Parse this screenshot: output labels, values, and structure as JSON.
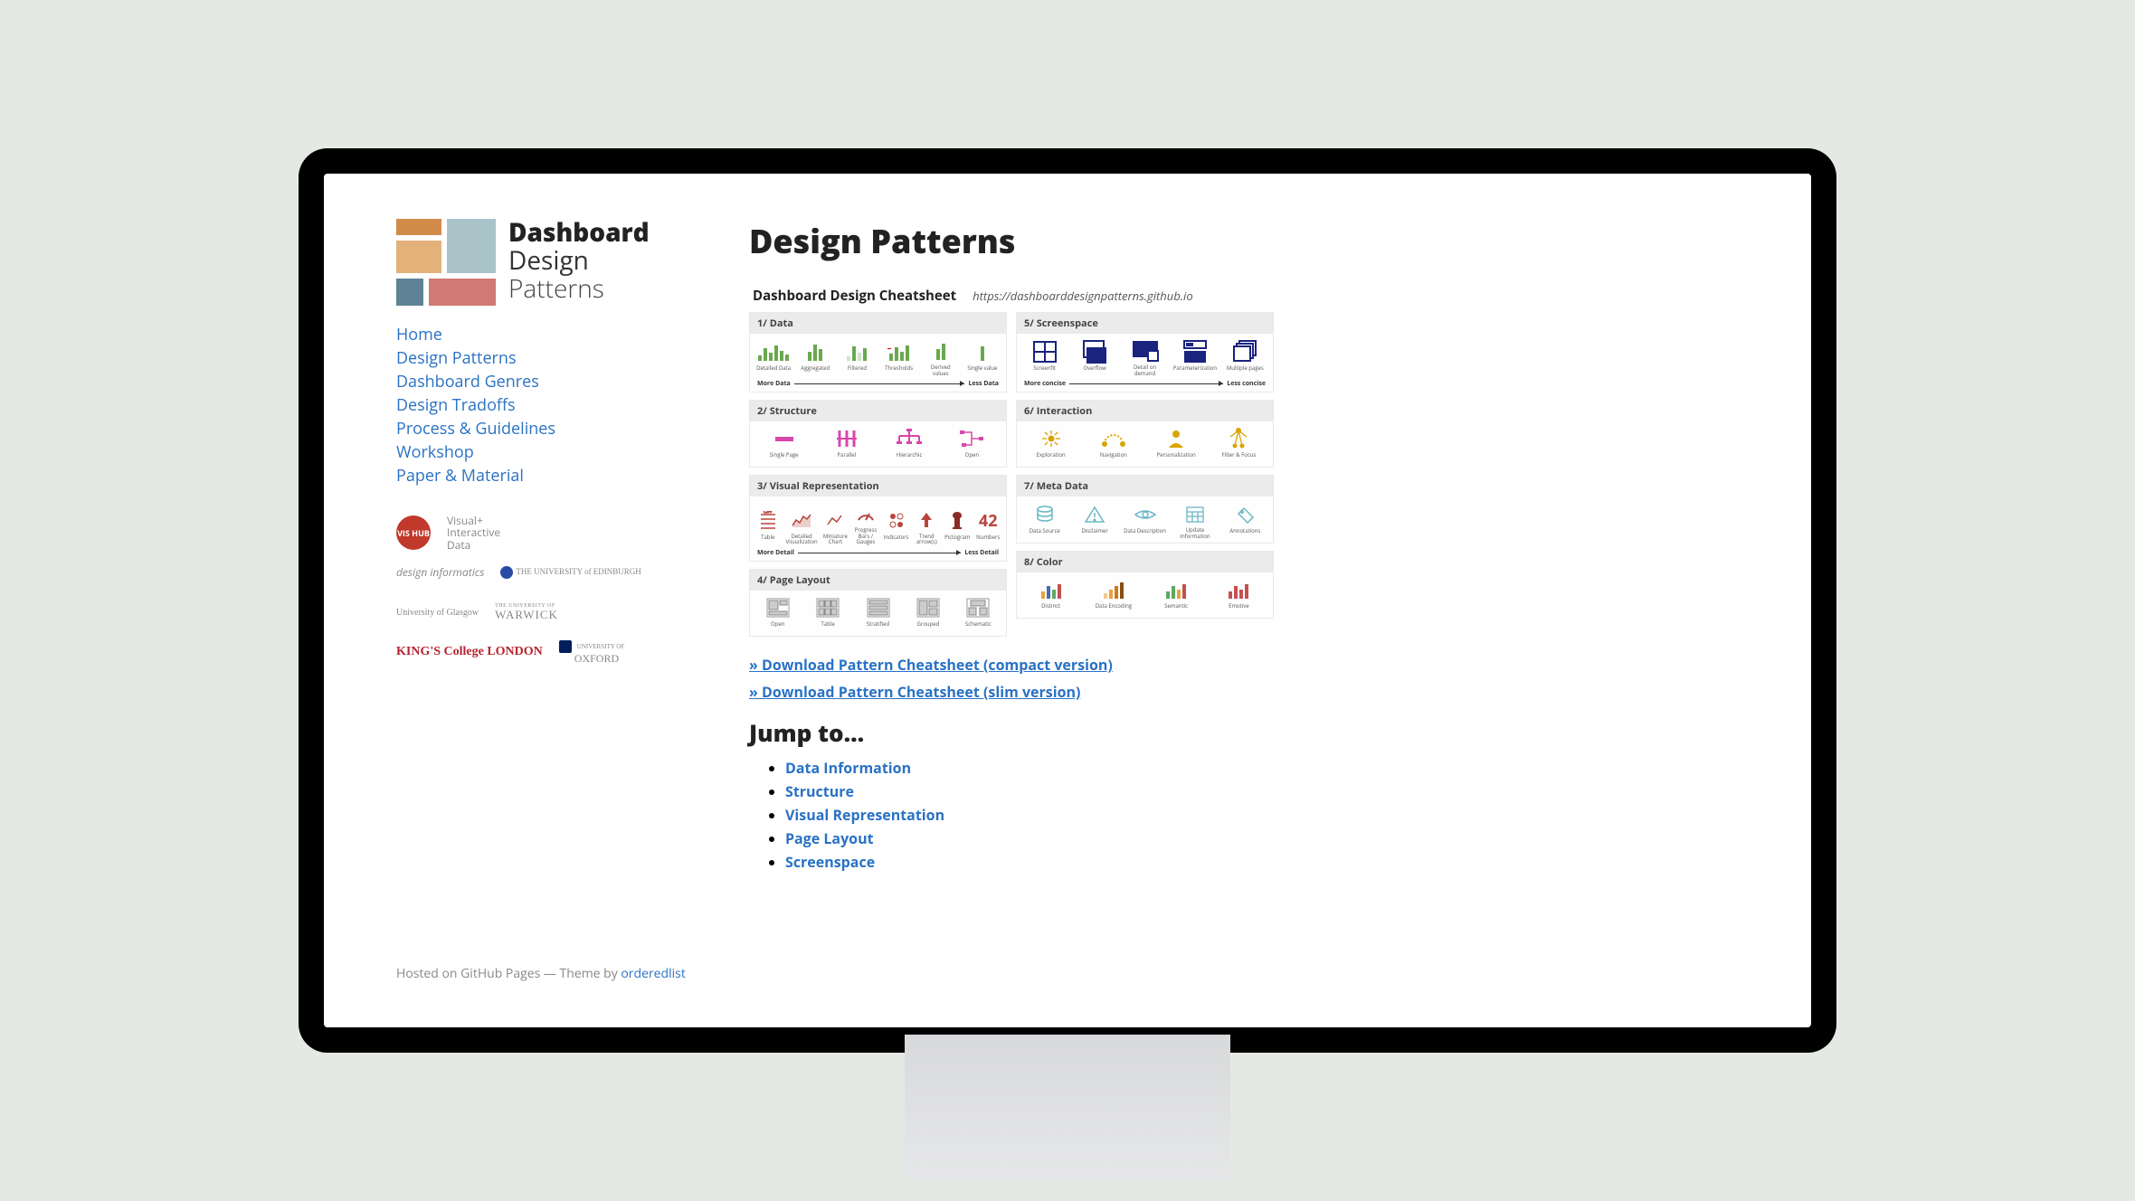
{
  "logo": {
    "line1": "Dashboard",
    "line2": "Design",
    "line3": "Patterns"
  },
  "nav": {
    "items": [
      {
        "label": "Home"
      },
      {
        "label": "Design Patterns"
      },
      {
        "label": "Dashboard Genres"
      },
      {
        "label": "Design Tradoffs"
      },
      {
        "label": "Process & Guidelines"
      },
      {
        "label": "Workshop"
      },
      {
        "label": "Paper & Material"
      }
    ]
  },
  "affiliations": {
    "vishub_label": "VIS HUB",
    "vishub_desc": "Visual+\nInteractive\nData",
    "design_informatics": "design informatics",
    "edinburgh": "THE UNIVERSITY of EDINBURGH",
    "glasgow": "University of Glasgow",
    "warwick_top": "THE UNIVERSITY OF",
    "warwick": "WARWICK",
    "kings": "KING'S College LONDON",
    "oxford_top": "UNIVERSITY OF",
    "oxford": "OXFORD"
  },
  "footer": {
    "prefix": "Hosted on GitHub Pages — Theme by ",
    "link": "orderedlist"
  },
  "page": {
    "title": "Design Patterns",
    "cheatsheet_title": "Dashboard Design Cheatsheet",
    "cheatsheet_url": "https://dashboarddesignpatterns.github.io",
    "download_compact": "» Download Pattern Cheatsheet (compact version)",
    "download_slim": "» Download Pattern Cheatsheet (slim version)",
    "jump_heading": "Jump to…"
  },
  "cheatsheet": {
    "s1": {
      "title": "1/ Data",
      "axis_left": "More Data",
      "axis_right": "Less Data",
      "items": [
        {
          "label": "Detailed Data"
        },
        {
          "label": "Aggregated"
        },
        {
          "label": "Filtered"
        },
        {
          "label": "Thresholds"
        },
        {
          "label": "Derived values"
        },
        {
          "label": "Single value"
        }
      ]
    },
    "s2": {
      "title": "2/ Structure",
      "items": [
        {
          "label": "Single Page"
        },
        {
          "label": "Parallel"
        },
        {
          "label": "Hierarchic"
        },
        {
          "label": "Open"
        }
      ]
    },
    "s3": {
      "title": "3/ Visual Representation",
      "axis_left": "More Detail",
      "axis_right": "Less Detail",
      "items": [
        {
          "label": "Table"
        },
        {
          "label": "Detailed Visualization"
        },
        {
          "label": "Miniature Chart"
        },
        {
          "label": "Progress Bars / Gauges"
        },
        {
          "label": "Indicators"
        },
        {
          "label": "Trend arrow(s)"
        },
        {
          "label": "Pictogram"
        },
        {
          "label": "Numbers"
        }
      ],
      "number_example": "42"
    },
    "s4": {
      "title": "4/ Page Layout",
      "items": [
        {
          "label": "Open"
        },
        {
          "label": "Table"
        },
        {
          "label": "Stratified"
        },
        {
          "label": "Grouped"
        },
        {
          "label": "Schematic"
        }
      ]
    },
    "s5": {
      "title": "5/ Screenspace",
      "axis_left": "More concise",
      "axis_right": "Less concise",
      "items": [
        {
          "label": "Screenfit"
        },
        {
          "label": "Overflow"
        },
        {
          "label": "Detail on demand"
        },
        {
          "label": "Parameterization"
        },
        {
          "label": "Multiple pages"
        }
      ]
    },
    "s6": {
      "title": "6/ Interaction",
      "items": [
        {
          "label": "Exploration"
        },
        {
          "label": "Navigation"
        },
        {
          "label": "Personalization"
        },
        {
          "label": "Filter & Focus"
        }
      ]
    },
    "s7": {
      "title": "7/  Meta Data",
      "items": [
        {
          "label": "Data Source"
        },
        {
          "label": "Disclaimer"
        },
        {
          "label": "Data Description"
        },
        {
          "label": "Update Information"
        },
        {
          "label": "Annotations"
        }
      ]
    },
    "s8": {
      "title": "8/ Color",
      "items": [
        {
          "label": "Distinct"
        },
        {
          "label": "Data Encoding"
        },
        {
          "label": "Semantic"
        },
        {
          "label": "Emotive"
        }
      ]
    }
  },
  "jump": {
    "items": [
      {
        "label": "Data Information"
      },
      {
        "label": "Structure"
      },
      {
        "label": "Visual Representation"
      },
      {
        "label": "Page Layout"
      },
      {
        "label": "Screenspace"
      }
    ]
  }
}
